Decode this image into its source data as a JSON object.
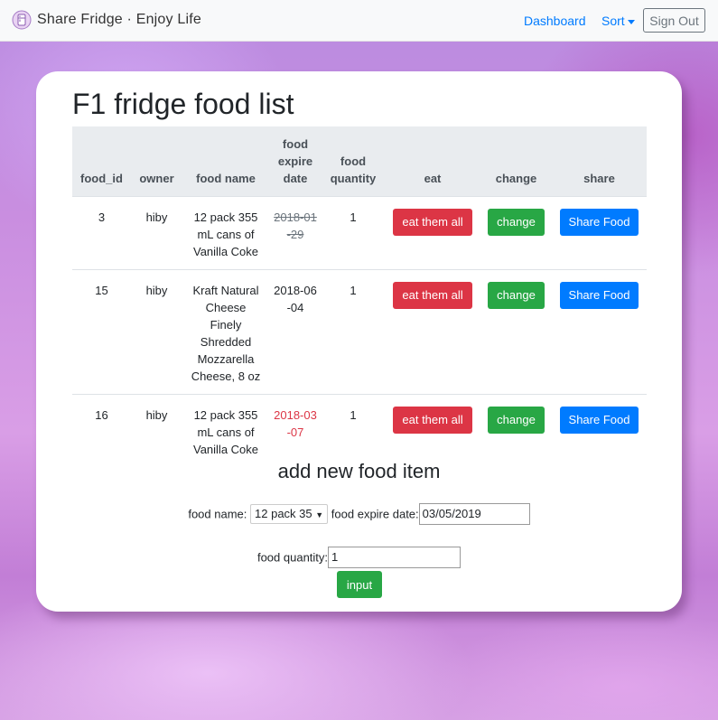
{
  "navbar": {
    "brand": "Share Fridge · Enjoy Life",
    "logo_icon": "fridge-logo-icon",
    "links": {
      "dashboard": "Dashboard",
      "sort": "Sort"
    },
    "sign_out": "Sign Out"
  },
  "page": {
    "title": "F1 fridge food list"
  },
  "table": {
    "headers": {
      "food_id": "food_id",
      "owner": "owner",
      "food_name": "food name",
      "food_expire_date": "food expire date",
      "food_quantity": "food quantity",
      "eat": "eat",
      "change": "change",
      "share": "share"
    },
    "rows": [
      {
        "food_id": "3",
        "owner": "hiby",
        "food_name": "12 pack 355 mL cans of Vanilla Coke",
        "expire": "2018-01-29",
        "expire_style": "strikethrough",
        "quantity": "1",
        "eat": "eat them all",
        "change": "change",
        "share": "Share Food"
      },
      {
        "food_id": "15",
        "owner": "hiby",
        "food_name": "Kraft Natural Cheese Finely Shredded Mozzarella Cheese, 8 oz",
        "expire": "2018-06-04",
        "expire_style": "normal",
        "quantity": "1",
        "eat": "eat them all",
        "change": "change",
        "share": "Share Food"
      },
      {
        "food_id": "16",
        "owner": "hiby",
        "food_name": "12 pack 355 mL cans of Vanilla Coke",
        "expire": "2018-03-07",
        "expire_style": "expired",
        "quantity": "1",
        "eat": "eat them all",
        "change": "change",
        "share": "Share Food"
      }
    ]
  },
  "form": {
    "title": "add new food item",
    "food_name_label": "food name:",
    "food_name_selected": "12 pack 35",
    "expire_label": "food expire date:",
    "expire_value": "03/05/2019",
    "quantity_label": "food quantity:",
    "quantity_value": "1",
    "submit": "input"
  },
  "colors": {
    "danger": "#dc3545",
    "success": "#28a745",
    "primary": "#007bff"
  }
}
